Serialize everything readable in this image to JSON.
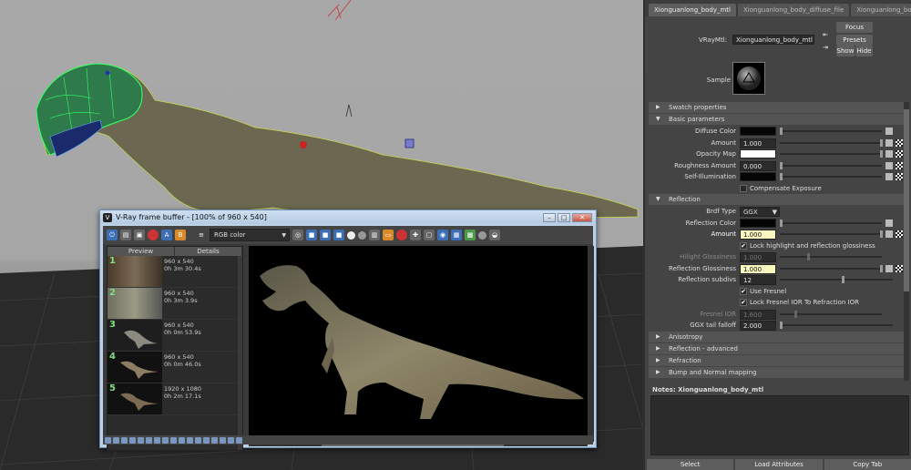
{
  "vfb": {
    "title": "V-Ray frame buffer - [100% of 960 x 540]",
    "channel": "RGB color",
    "history_headers": [
      "Preview",
      "Details"
    ],
    "history": [
      {
        "num": "1",
        "res": "960 x 540",
        "time": "0h 3m 30.4s"
      },
      {
        "num": "2",
        "res": "960 x 540",
        "time": "0h 3m 3.9s"
      },
      {
        "num": "3",
        "res": "960 x 540",
        "time": "0h 0m 53.9s"
      },
      {
        "num": "4",
        "res": "960 x 540",
        "time": "0h 0m 46.0s"
      },
      {
        "num": "5",
        "res": "1920 x 1080",
        "time": "0h 2m 17.1s"
      }
    ]
  },
  "ae": {
    "tabs": [
      "Xionguanlong_body_mtl",
      "Xionguanlong_body_diffuse_file",
      "Xionguanlong_boc"
    ],
    "type_label": "VRayMtl:",
    "name_value": "Xionguanlong_body_mtl",
    "focus": "Focus",
    "presets": "Presets",
    "show": "Show",
    "hide": "Hide",
    "sample_label": "Sample",
    "sections": {
      "swatch": "Swatch properties",
      "basic": "Basic parameters",
      "reflection": "Reflection",
      "anisotropy": "Anisotropy",
      "refl_adv": "Reflection - advanced",
      "refraction": "Refraction",
      "bump": "Bump and Normal mapping"
    },
    "basic": {
      "diffuse_color": "Diffuse Color",
      "amount": "Amount",
      "amount_value": "1.000",
      "opacity_map": "Opacity Map",
      "roughness": "Roughness Amount",
      "roughness_value": "0.000",
      "self_illum": "Self-Illumination",
      "compensate": "Compensate Exposure"
    },
    "reflection": {
      "brdf_type": "Brdf Type",
      "brdf_value": "GGX",
      "refl_color": "Reflection Color",
      "amount": "Amount",
      "amount_value": "1.000",
      "lock_hilight": "Lock highlight and reflection glossiness",
      "hilight_gloss": "Hilight Glossiness",
      "hilight_gloss_value": "1.000",
      "refl_gloss": "Reflection Glossiness",
      "refl_gloss_value": "1.000",
      "refl_subdivs": "Reflection subdivs",
      "refl_subdivs_value": "12",
      "use_fresnel": "Use Fresnel",
      "lock_fresnel": "Lock Fresnel IOR To Refraction IOR",
      "fresnel_ior": "Fresnel IOR",
      "fresnel_ior_value": "1.600",
      "ggx_tail": "GGX tail falloff",
      "ggx_tail_value": "2.000"
    },
    "notes_label": "Notes: Xionguanlong_body_mtl",
    "footer": [
      "Select",
      "Load Attributes",
      "Copy Tab"
    ]
  },
  "colors": {
    "accent_yellow": "#fbf7c0",
    "wireframe_green": "#33ff66",
    "history_number": "#7ee07e"
  }
}
